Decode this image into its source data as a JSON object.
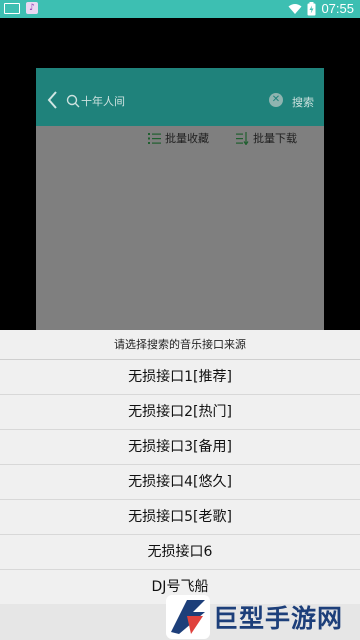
{
  "status_bar": {
    "time": "07:55",
    "icons": [
      "keyboard-icon",
      "app-notification-icon",
      "wifi-icon",
      "battery-icon"
    ]
  },
  "app": {
    "search": {
      "value": "十年人间",
      "button": "搜索"
    },
    "toolbar": {
      "batch_favorite": "批量收藏",
      "batch_download": "批量下载"
    }
  },
  "sheet": {
    "title": "请选择搜索的音乐接口来源",
    "options": [
      "无损接口1[推荐]",
      "无损接口2[热门]",
      "无损接口3[备用]",
      "无损接口4[悠久]",
      "无损接口5[老歌]",
      "无损接口6",
      "DJ号飞船"
    ]
  },
  "watermark": {
    "text": "巨型手游网"
  },
  "colors": {
    "status_bar": "#3dbfb2",
    "header": "#1f827b",
    "sheet_bg": "#f0f0f0",
    "watermark": "#1d3f7a"
  }
}
